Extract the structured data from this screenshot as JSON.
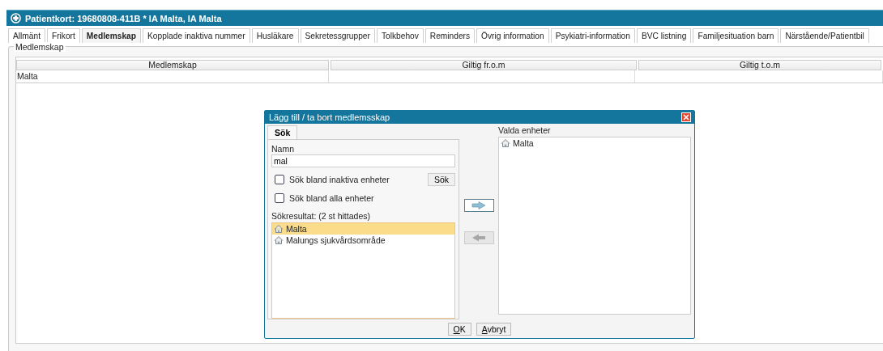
{
  "window": {
    "title": "Patientkort: 19680808-411B * IA Malta, IA Malta"
  },
  "tabs": [
    {
      "label": "Allmänt",
      "selected": false
    },
    {
      "label": "Frikort",
      "selected": false
    },
    {
      "label": "Medlemskap",
      "selected": true
    },
    {
      "label": "Kopplade inaktiva nummer",
      "selected": false
    },
    {
      "label": "Husläkare",
      "selected": false
    },
    {
      "label": "Sekretessgrupper",
      "selected": false
    },
    {
      "label": "Tolkbehov",
      "selected": false
    },
    {
      "label": "Reminders",
      "selected": false
    },
    {
      "label": "Övrig information",
      "selected": false
    },
    {
      "label": "Psykiatri-information",
      "selected": false
    },
    {
      "label": "BVC listning",
      "selected": false
    },
    {
      "label": "Familjesituation barn",
      "selected": false
    },
    {
      "label": "Närstående/Patientbil",
      "selected": false
    }
  ],
  "group": {
    "title": "Medlemskap"
  },
  "table": {
    "columns": [
      "Medlemskap",
      "Giltig fr.o.m",
      "Giltig t.o.m"
    ],
    "rows": [
      [
        "Malta"
      ]
    ]
  },
  "dialog": {
    "title": "Lägg till / ta bort medlemsskap",
    "tabs": [
      {
        "label": "Sök",
        "selected": true
      }
    ],
    "name_label": "Namn",
    "name_value": "mal",
    "checkboxes": [
      {
        "label": "Sök bland inaktiva enheter",
        "checked": false
      },
      {
        "label": "Sök bland alla enheter",
        "checked": false
      }
    ],
    "search_button": "Sök",
    "results_label": "Sökresultat: (2 st hittades)",
    "results": [
      {
        "label": "Malta",
        "selected": true
      },
      {
        "label": "Malungs sjukvårdsområde",
        "selected": false
      }
    ],
    "add_button": {
      "disabled": false
    },
    "remove_button": {
      "disabled": true
    },
    "selected_label": "Valda enheter",
    "selected_units": [
      "Malta"
    ],
    "buttons": [
      "OK",
      "Avbryt"
    ]
  }
}
